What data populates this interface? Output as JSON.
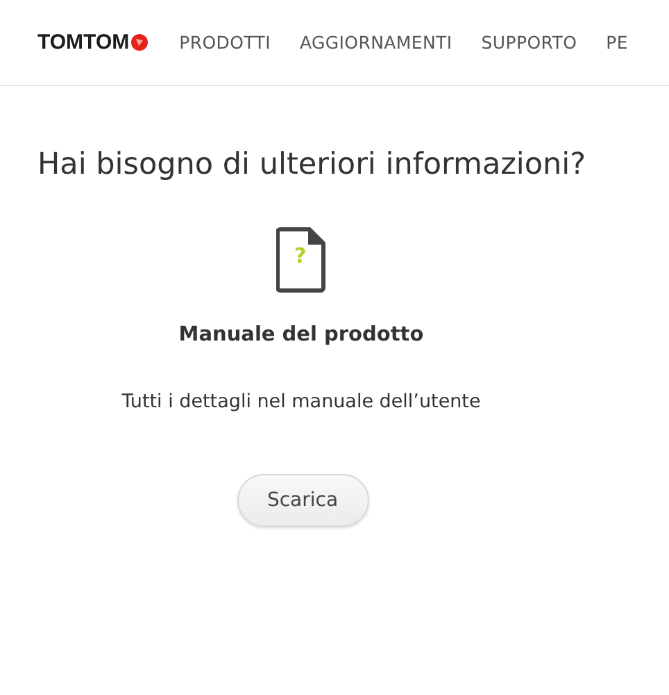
{
  "header": {
    "logo": "TOMTOM",
    "nav": [
      "PRODOTTI",
      "AGGIORNAMENTI",
      "SUPPORTO",
      "PE"
    ]
  },
  "section": {
    "title": "Hai bisogno di ulteriori informazioni?",
    "icon_mark": "?",
    "heading": "Manuale del prodotto",
    "description": "Tutti i dettagli nel manuale dell’utente",
    "button": "Scarica"
  }
}
